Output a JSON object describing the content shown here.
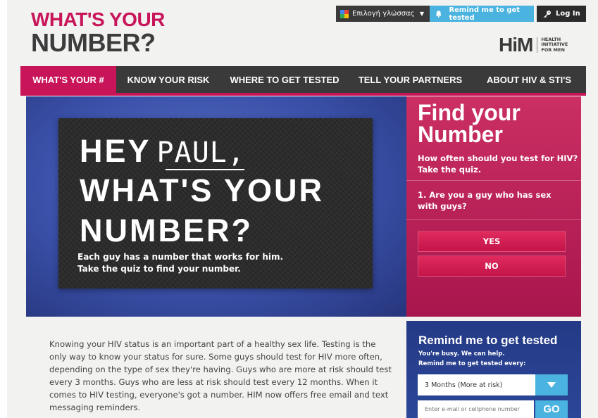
{
  "logo": {
    "line1": "WHAT'S YOUR",
    "line2": "NUMBER?"
  },
  "topbar": {
    "language_label": "Επιλογή γλώσσας",
    "remind_label": "Remind me to get tested",
    "login_label": "Log In"
  },
  "partner_logo": {
    "mark": "HiM",
    "text_line1": "HEALTH",
    "text_line2": "INITIATIVE",
    "text_line3": "FOR MEN"
  },
  "nav": {
    "items": [
      {
        "label": "WHAT'S YOUR #"
      },
      {
        "label": "KNOW YOUR RISK"
      },
      {
        "label": "WHERE TO GET TESTED"
      },
      {
        "label": "TELL YOUR PARTNERS"
      },
      {
        "label": "ABOUT HIV & STI'S"
      }
    ]
  },
  "hero": {
    "greeting": "HEY",
    "name": "PAUL,",
    "line2": "WHAT'S YOUR",
    "line3": "NUMBER?",
    "sub1": "Each guy has a number that works for him.",
    "sub2": "Take the quiz to find your number."
  },
  "quiz": {
    "title_line1": "Find your",
    "title_line2": "Number",
    "subtitle_line1": "How often should you test for HIV?",
    "subtitle_line2": "Take the quiz.",
    "question": "1. Are you a guy who has sex with guys?",
    "yes_label": "YES",
    "no_label": "NO"
  },
  "body": {
    "paragraph": "Knowing your HIV status is an important part of a healthy sex life. Testing is the only way to know your status for sure. Some guys should test for HIV more often, depending on the type of sex they're having. Guys who are more at risk should test every 3 months. Guys who are less at risk should test every 12 months. When it comes to HIV testing, everyone's got a number. HIM now offers free email and text messaging reminders."
  },
  "remind": {
    "title": "Remind me to get tested",
    "sub1": "You're busy. We can help.",
    "sub2": "Remind me to get tested every:",
    "frequency_value": "3 Months (More at risk)",
    "input_placeholder": "Enter e-mail or cellphone number",
    "go_label": "GO"
  },
  "colors": {
    "brand_pink": "#c8155a",
    "nav_dark": "#3a3a3a",
    "accent_blue": "#4ab3df",
    "panel_navy": "#243a86"
  }
}
